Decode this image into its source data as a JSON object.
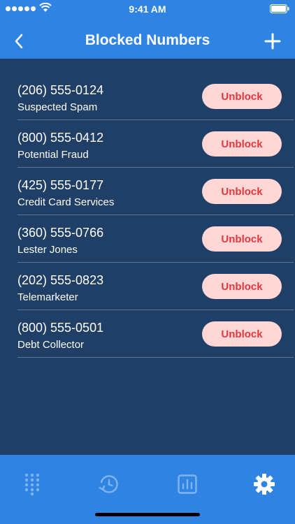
{
  "status_bar": {
    "time": "9:41 AM"
  },
  "header": {
    "title": "Blocked Numbers"
  },
  "blocked_numbers": [
    {
      "phone": "(206) 555-0124",
      "label": "Suspected Spam",
      "action": "Unblock"
    },
    {
      "phone": "(800) 555-0412",
      "label": "Potential Fraud",
      "action": "Unblock"
    },
    {
      "phone": "(425) 555-0177",
      "label": "Credit Card Services",
      "action": "Unblock"
    },
    {
      "phone": "(360) 555-0766",
      "label": "Lester Jones",
      "action": "Unblock"
    },
    {
      "phone": "(202) 555-0823",
      "label": "Telemarketer",
      "action": "Unblock"
    },
    {
      "phone": "(800) 555-0501",
      "label": "Debt Collector",
      "action": "Unblock"
    }
  ],
  "tabs": [
    {
      "icon": "keypad-icon"
    },
    {
      "icon": "recent-clock-icon"
    },
    {
      "icon": "stats-chart-icon"
    },
    {
      "icon": "gear-icon",
      "active": true
    }
  ],
  "colors": {
    "header_bg": "#2f84e3",
    "list_bg": "#1f3f66",
    "unblock_bg": "#ffd7d7",
    "unblock_text": "#e2383c"
  }
}
